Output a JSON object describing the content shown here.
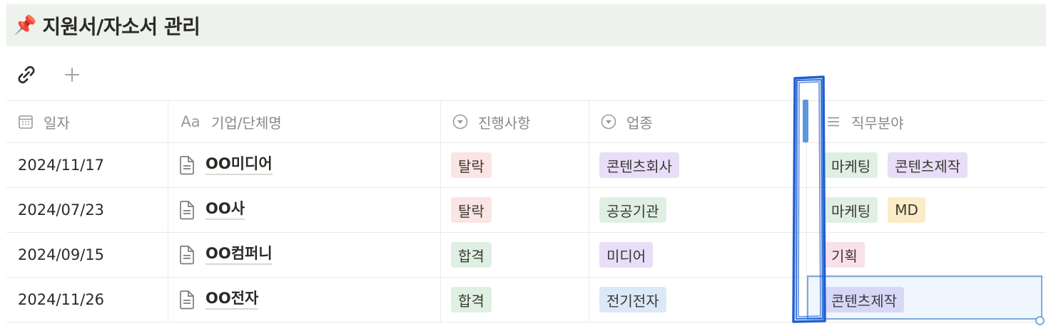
{
  "header": {
    "pin_icon": "📌",
    "title": "지원서/자소서 관리"
  },
  "toolbar": {
    "link_icon": "paperclip-icon",
    "add_icon": "plus-icon"
  },
  "table": {
    "columns": [
      {
        "label": "일자",
        "icon": "calendar-icon"
      },
      {
        "label": "기업/단체명",
        "icon": "Aa"
      },
      {
        "label": "진행사항",
        "icon": "select-icon"
      },
      {
        "label": "업종",
        "icon": "select-icon"
      },
      {
        "label": "직무분야",
        "icon": "list-icon"
      }
    ],
    "rows": [
      {
        "date": "2024/11/17",
        "name": "OO미디어",
        "status": "탈락",
        "industry": "콘텐츠회사",
        "jobs": [
          "마케팅",
          "콘텐츠제작"
        ]
      },
      {
        "date": "2024/07/23",
        "name": "OO사",
        "status": "탈락",
        "industry": "공공기관",
        "jobs": [
          "마케팅",
          "MD"
        ]
      },
      {
        "date": "2024/09/15",
        "name": "OO컴퍼니",
        "status": "합격",
        "industry": "미디어",
        "jobs": [
          "기획"
        ]
      },
      {
        "date": "2024/11/26",
        "name": "OO전자",
        "status": "합격",
        "industry": "전기전자",
        "jobs": [
          "콘텐츠제작"
        ]
      }
    ]
  },
  "colors": {
    "header_bg": "#eef2ec",
    "tag_red": "#fbe4e4",
    "tag_green": "#dff0e3",
    "tag_purple": "#e8def8",
    "tag_blue": "#dbe8f7",
    "tag_yellow": "#fbecc8",
    "tag_pink": "#f9e0ea",
    "selection_border": "#7fa8d9",
    "annotation_blue": "#1f5fd1"
  }
}
